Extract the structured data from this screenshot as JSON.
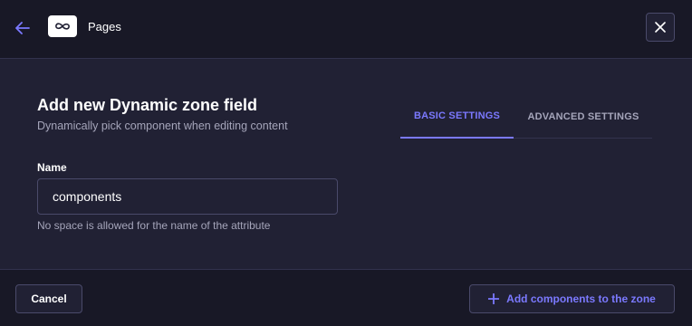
{
  "header": {
    "back_icon": "arrow-left-icon",
    "type_icon": "dynamic-zone-icon",
    "title": "Pages",
    "close_icon": "close-icon"
  },
  "modal": {
    "title": "Add new Dynamic zone field",
    "subtitle": "Dynamically pick component when editing content"
  },
  "tabs": [
    {
      "label": "BASIC SETTINGS",
      "active": true
    },
    {
      "label": "ADVANCED SETTINGS",
      "active": false
    }
  ],
  "form": {
    "name_label": "Name",
    "name_value": "components",
    "name_hint": "No space is allowed for the name of the attribute"
  },
  "footer": {
    "cancel_label": "Cancel",
    "add_label": "Add components to the zone",
    "add_icon": "plus-icon"
  },
  "colors": {
    "background": "#212134",
    "header_background": "#181826",
    "accent": "#7b79ff",
    "muted_text": "#a5a5ba",
    "border": "#32324d"
  }
}
